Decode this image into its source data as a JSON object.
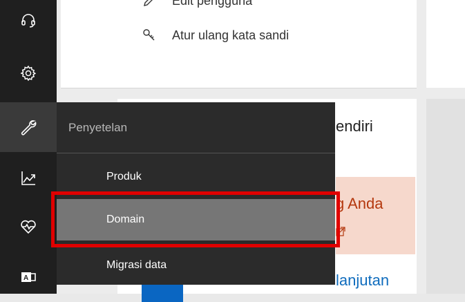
{
  "rail": {
    "items": [
      {
        "icon": "headset-icon",
        "label": "Support"
      },
      {
        "icon": "gear-icon",
        "label": "Settings"
      },
      {
        "icon": "wrench-icon",
        "label": "Setup",
        "active": true
      },
      {
        "icon": "chart-line-icon",
        "label": "Reports"
      },
      {
        "icon": "heart-pulse-icon",
        "label": "Health"
      },
      {
        "icon": "exchange-icon",
        "label": "Exchange"
      }
    ]
  },
  "user_actions": {
    "edit_user": "Edit pengguna",
    "reset_password": "Atur ulang kata sandi"
  },
  "cards": {
    "title_fragment": "endiri",
    "promo_fragment": "g Anda",
    "training_fragment": "lanjutan"
  },
  "flyout": {
    "header": "Penyetelan",
    "items": [
      {
        "label": "Produk"
      },
      {
        "label": "Domain",
        "selected": true
      },
      {
        "label": "Migrasi data"
      }
    ]
  },
  "colors": {
    "rail_bg": "#1f1f1f",
    "flyout_bg": "#2b2b2b",
    "selected_bg": "#767676",
    "highlight": "#e00000",
    "promo_text": "#b4380e",
    "link": "#0f6cbd"
  }
}
